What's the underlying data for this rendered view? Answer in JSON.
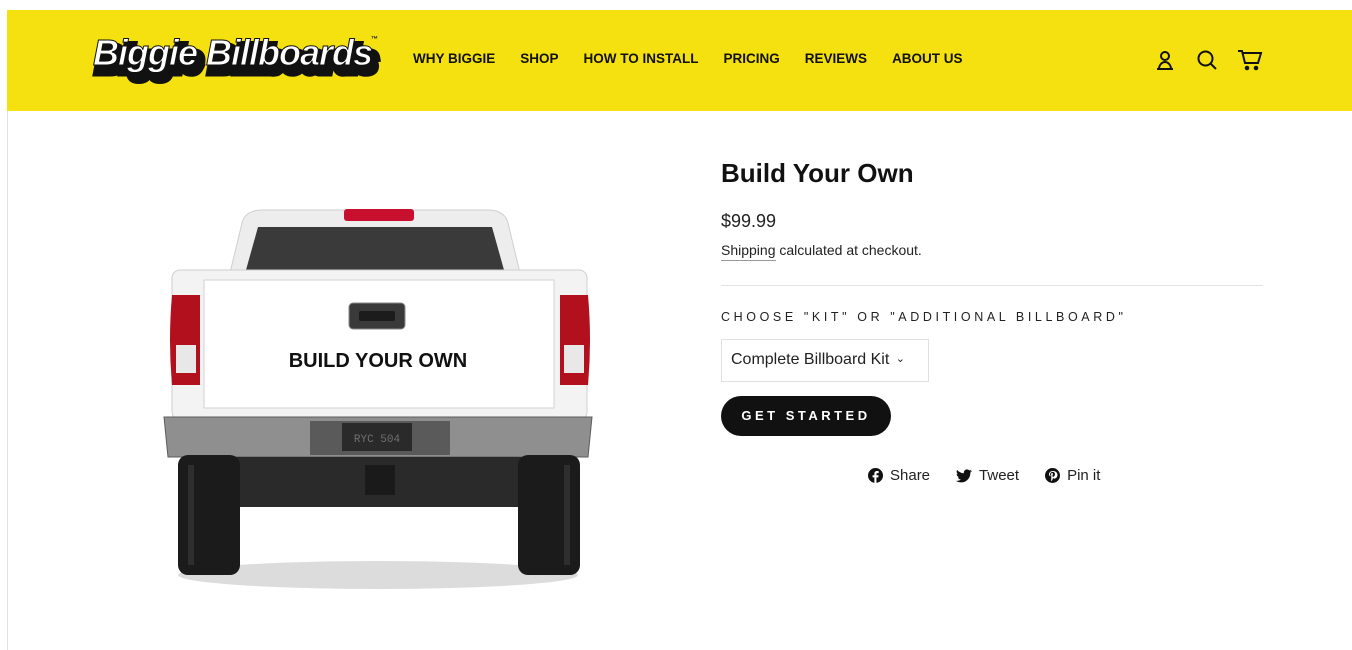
{
  "brand": {
    "logo_text": "Biggie Billboards",
    "trademark": "™"
  },
  "nav": {
    "items": [
      {
        "label": "WHY BIGGIE"
      },
      {
        "label": "SHOP"
      },
      {
        "label": "HOW TO INSTALL"
      },
      {
        "label": "PRICING"
      },
      {
        "label": "REVIEWS"
      },
      {
        "label": "ABOUT US"
      }
    ],
    "icons": [
      "account-icon",
      "search-icon",
      "cart-icon"
    ]
  },
  "product": {
    "image_text": "BUILD YOUR OWN",
    "plate_text": "RYC 504",
    "title": "Build Your Own",
    "price": "$99.99",
    "shipping_link": "Shipping",
    "shipping_rest": " calculated at checkout.",
    "option_label": "CHOOSE \"KIT\" OR \"ADDITIONAL BILLBOARD\"",
    "option_selected": "Complete Billboard Kit",
    "cta_label": "GET STARTED"
  },
  "share": {
    "facebook": "Share",
    "twitter": "Tweet",
    "pinterest": "Pin it"
  },
  "colors": {
    "header_bg": "#f5e10f",
    "cta_bg": "#111111",
    "text": "#111111"
  }
}
